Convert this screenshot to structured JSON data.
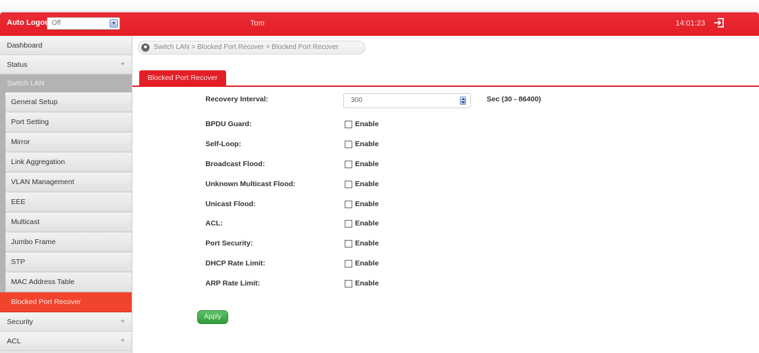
{
  "header": {
    "auto_logout_label": "Auto Logout :",
    "auto_logout_value": "Off",
    "user": "Tom",
    "time": "14:01:23",
    "accent_color": "#e31e27"
  },
  "sidebar": {
    "items": [
      {
        "label": "Dashboard"
      },
      {
        "label": "Status",
        "expander": "+"
      },
      {
        "label": "Switch LAN"
      },
      {
        "label": "Security",
        "expander": "+"
      },
      {
        "label": "ACL",
        "expander": "+"
      }
    ],
    "switch_lan_children": [
      {
        "label": "General Setup"
      },
      {
        "label": "Port Setting"
      },
      {
        "label": "Mirror"
      },
      {
        "label": "Link Aggregation"
      },
      {
        "label": "VLAN Management"
      },
      {
        "label": "EEE"
      },
      {
        "label": "Multicast"
      },
      {
        "label": "Jumbo Frame"
      },
      {
        "label": "STP"
      },
      {
        "label": "MAC Address Table"
      },
      {
        "label": "Blocked Port Recover"
      }
    ]
  },
  "breadcrumb": "Switch LAN  > Blocked Port Recover  > Blocked Port Recover",
  "tab": "Blocked Port Recover",
  "form": {
    "recovery_interval_label": "Recovery Interval:",
    "recovery_interval_value": "300",
    "recovery_interval_hint": "Sec (30 - 86400)",
    "enable_label": "Enable",
    "rows": [
      {
        "label": "BPDU Guard:",
        "checked": false
      },
      {
        "label": "Self-Loop:",
        "checked": false
      },
      {
        "label": "Broadcast Flood:",
        "checked": false
      },
      {
        "label": "Unknown Multicast Flood:",
        "checked": false
      },
      {
        "label": "Unicast Flood:",
        "checked": false
      },
      {
        "label": "ACL:",
        "checked": false
      },
      {
        "label": "Port Security:",
        "checked": false
      },
      {
        "label": "DHCP Rate Limit:",
        "checked": false
      },
      {
        "label": "ARP Rate Limit:",
        "checked": false
      }
    ],
    "apply_label": "Apply"
  }
}
